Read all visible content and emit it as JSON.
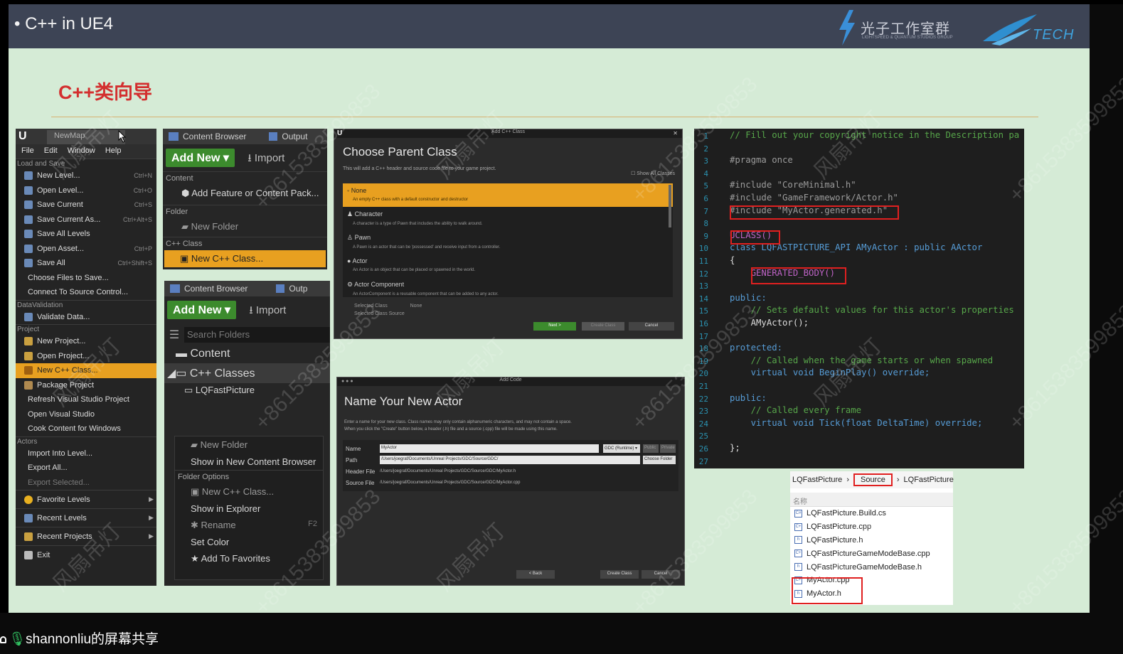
{
  "slide": {
    "title": "C++ in UE4",
    "heading": "C++类向导",
    "logo_cn": "光子工作室群",
    "logo_en": "LIGHTSPEED & QUANTUM STUDIOS GROUP",
    "logo2": "TECH"
  },
  "share": {
    "label": "shannonliu的屏幕共享"
  },
  "file_menu": {
    "app_icon": "U",
    "map_tab": "NewMap",
    "menus": [
      "File",
      "Edit",
      "Window",
      "Help"
    ],
    "sections": {
      "load_save": "Load and Save",
      "data_validation": "DataValidation",
      "project": "Project",
      "actors": "Actors"
    },
    "items": [
      {
        "label": "New Level...",
        "shortcut": "Ctrl+N"
      },
      {
        "label": "Open Level...",
        "shortcut": "Ctrl+O"
      },
      {
        "label": "Save Current",
        "shortcut": "Ctrl+S"
      },
      {
        "label": "Save Current As...",
        "shortcut": "Ctrl+Alt+S"
      },
      {
        "label": "Save All Levels",
        "shortcut": ""
      },
      {
        "label": "Open Asset...",
        "shortcut": "Ctrl+P"
      },
      {
        "label": "Save All",
        "shortcut": "Ctrl+Shift+S"
      },
      {
        "label": "Choose Files to Save...",
        "shortcut": ""
      },
      {
        "label": "Connect To Source Control...",
        "shortcut": ""
      },
      {
        "label": "Validate Data...",
        "shortcut": ""
      },
      {
        "label": "New Project...",
        "shortcut": ""
      },
      {
        "label": "Open Project...",
        "shortcut": ""
      },
      {
        "label": "New C++ Class...",
        "shortcut": ""
      },
      {
        "label": "Package Project",
        "shortcut": ""
      },
      {
        "label": "Refresh Visual Studio Project",
        "shortcut": ""
      },
      {
        "label": "Open Visual Studio",
        "shortcut": ""
      },
      {
        "label": "Cook Content for Windows",
        "shortcut": ""
      },
      {
        "label": "Import Into Level...",
        "shortcut": ""
      },
      {
        "label": "Export All...",
        "shortcut": ""
      },
      {
        "label": "Export Selected...",
        "shortcut": ""
      },
      {
        "label": "Favorite Levels",
        "shortcut": ""
      },
      {
        "label": "Recent Levels",
        "shortcut": ""
      },
      {
        "label": "Recent Projects",
        "shortcut": ""
      },
      {
        "label": "Exit",
        "shortcut": ""
      }
    ]
  },
  "cb1": {
    "tab": "Content Browser",
    "tab2": "Output",
    "add_new": "Add New",
    "import": "Import",
    "content_lbl": "Content",
    "add_feature": "Add Feature or Content Pack...",
    "folder_lbl": "Folder",
    "new_folder": "New Folder",
    "cpp_lbl": "C++ Class",
    "new_cpp": "New C++ Class..."
  },
  "cb2": {
    "tab": "Content Browser",
    "tab2": "Outp",
    "add_new": "Add New",
    "import": "Import",
    "search": "Search Folders",
    "content": "Content",
    "cpp_classes": "C++ Classes",
    "lq": "LQFastPicture",
    "ctx": {
      "new_folder": "New Folder",
      "show_cb": "Show in New Content Browser",
      "folder_options": "Folder Options",
      "new_cpp": "New C++ Class...",
      "show_explorer": "Show in Explorer",
      "rename": "Rename",
      "rename_key": "F2",
      "set_color": "Set Color",
      "add_fav": "Add To Favorites"
    }
  },
  "parent_dialog": {
    "titlebar": "Add C++ Class",
    "title": "Choose Parent Class",
    "desc": "This will add a C++ header and source code file to your game project.",
    "show_all": "Show All Classes",
    "options": [
      {
        "name": "None",
        "desc": "An empty C++ class with a default constructor and destructor"
      },
      {
        "name": "Character",
        "desc": "A character is a type of Pawn that includes the ability to walk around."
      },
      {
        "name": "Pawn",
        "desc": "A Pawn is an actor that can be 'possessed' and receive input from a controller."
      },
      {
        "name": "Actor",
        "desc": "An Actor is an object that can be placed or spawned in the world."
      },
      {
        "name": "Actor Component",
        "desc": "An ActorComponent is a reusable component that can be added to any actor."
      }
    ],
    "selected_class": "Selected Class",
    "selected_class_val": "None",
    "selected_source": "Selected Class Source",
    "next": "Next >",
    "create": "Create Class",
    "cancel": "Cancel"
  },
  "name_dialog": {
    "titlebar": "Add Code",
    "title": "Name Your New Actor",
    "desc1": "Enter a name for your new class. Class names may only contain alphanumeric characters, and may not contain a space.",
    "desc2": "When you click the \"Create\" button below, a header (.h) file and a source (.cpp) file will be made using this name.",
    "name_lbl": "Name",
    "name_val": "MyActor",
    "module": "GDC (Runtime) ▾",
    "public": "Public",
    "private": "Private",
    "path_lbl": "Path",
    "path_val": "/Users/joegraf/Documents/Unreal Projects/GDC/Source/GDC/",
    "choose": "Choose Folder",
    "header_lbl": "Header File",
    "header_val": "/Users/joegraf/Documents/Unreal Projects/GDC/Source/GDC/MyActor.h",
    "source_lbl": "Source File",
    "source_val": "/Users/joegraf/Documents/Unreal Projects/GDC/Source/GDC/MyActor.cpp",
    "back": "< Back",
    "create": "Create Class",
    "cancel": "Cancel"
  },
  "code": {
    "lines": [
      "// Fill out your copyright notice in the Description pa",
      "",
      "#pragma once",
      "",
      "#include \"CoreMinimal.h\"",
      "#include \"GameFramework/Actor.h\"",
      "#include \"MyActor.generated.h\"",
      "",
      "UCLASS()",
      "class LQFASTPICTURE_API AMyActor : public AActor",
      "{",
      "    GENERATED_BODY()",
      "",
      "public:",
      "    // Sets default values for this actor's properties",
      "    AMyActor();",
      "",
      "protected:",
      "    // Called when the game starts or when spawned",
      "    virtual void BeginPlay() override;",
      "",
      "public:",
      "    // Called every frame",
      "    virtual void Tick(float DeltaTime) override;",
      "",
      "};",
      ""
    ]
  },
  "explorer": {
    "crumbs": [
      "LQFastPicture",
      "Source",
      "LQFastPicture"
    ],
    "col": "名称",
    "files": [
      "LQFastPicture.Build.cs",
      "LQFastPicture.cpp",
      "LQFastPicture.h",
      "LQFastPictureGameModeBase.cpp",
      "LQFastPictureGameModeBase.h",
      "MyActor.cpp",
      "MyActor.h"
    ]
  },
  "watermark": {
    "a": "风扇吊灯",
    "b": "+8615383599853"
  }
}
